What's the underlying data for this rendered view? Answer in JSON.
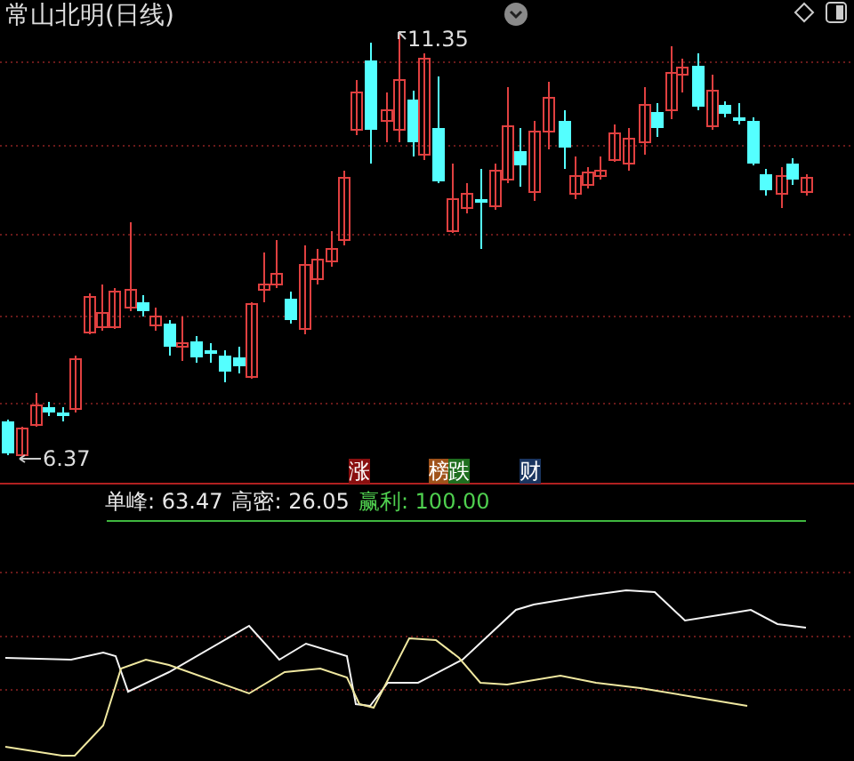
{
  "title": "常山北明(日线)",
  "price_labels": {
    "high": "11.35",
    "low": "6.37"
  },
  "markers": [
    {
      "label": "涨",
      "color": "#8a1010"
    },
    {
      "label": "榜",
      "color": "#a0521a"
    },
    {
      "label": "跌",
      "color": "#1f6e1f"
    },
    {
      "label": "财",
      "color": "#1a3560"
    }
  ],
  "indicators": [
    {
      "text": "单峰: 63.47",
      "color": "#e8e8e8"
    },
    {
      "text": "高密: 26.05",
      "color": "#e8e8e8"
    },
    {
      "text": "赢利: 100.00",
      "color": "#4fd04f"
    }
  ]
}
